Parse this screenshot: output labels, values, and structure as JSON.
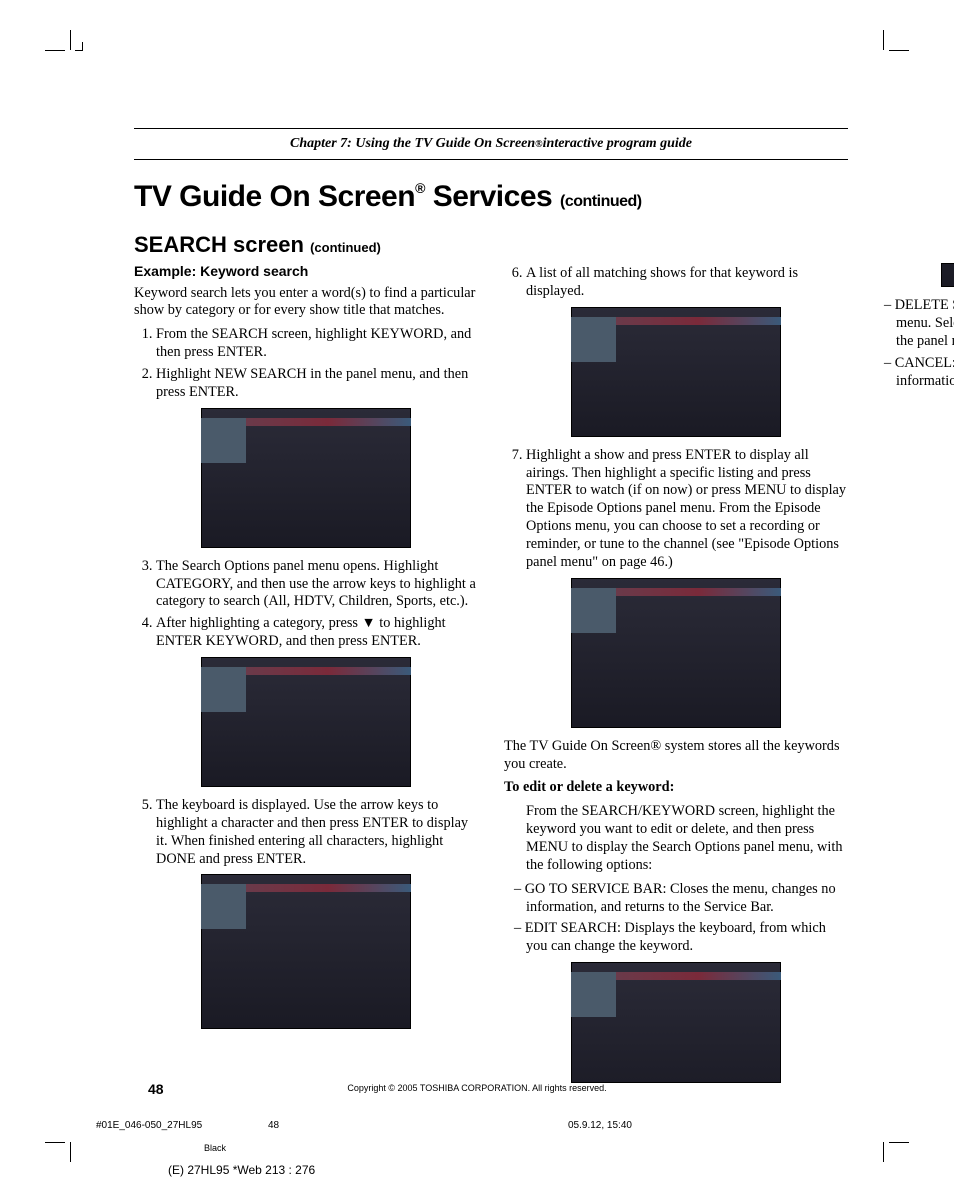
{
  "chapter": {
    "prefix": "Chapter 7: Using the TV Guide On Screen",
    "suffix": " interactive program guide"
  },
  "title": {
    "main1": "TV Guide On Screen",
    "main2": " Services ",
    "cont": "(continued)"
  },
  "subtitle": {
    "main": "SEARCH screen ",
    "cont": "(continued)"
  },
  "left": {
    "h4": "Example: Keyword search",
    "intro": "Keyword search lets you enter a word(s) to find a particular show by category or for every show title that matches.",
    "li1": "From the SEARCH screen, highlight KEYWORD, and then press ENTER.",
    "li2": "Highlight NEW SEARCH in the panel menu, and then press ENTER.",
    "li3": "The Search Options panel menu opens. Highlight CATEGORY, and then use the arrow keys to highlight a category to search (All, HDTV, Children, Sports, etc.).",
    "li4a": "After highlighting a category, press ",
    "li4b": " to highlight ENTER KEYWORD, and then press ENTER.",
    "li5": "The keyboard is displayed. Use the arrow keys to highlight a character and then press ENTER to display it. When finished entering all characters, highlight DONE and press ENTER."
  },
  "right": {
    "li6": "A list of all matching shows for that keyword is displayed.",
    "li7": "Highlight a show and press ENTER to display all airings. Then highlight a specific listing and press ENTER to watch (if on now) or press MENU to display the Episode Options panel menu. From the Episode Options menu, you can choose to set a recording or reminder, or tune to the channel (see \"Episode Options panel menu\" on page 46.)",
    "store": "The TV Guide On Screen® system stores all the keywords you create.",
    "editHdr": "To edit or delete a keyword:",
    "editBody": "From the SEARCH/KEYWORD screen, highlight the keyword you want to edit or delete, and then press MENU to display the Search Options panel menu, with the following options:",
    "opt1": "GO TO SERVICE BAR: Closes the menu, changes no information, and returns to the Service Bar.",
    "opt2": "EDIT SEARCH: Displays the keyboard, from which you can change the keyword.",
    "opt3": "DELETE SEARCH: Displays the Confirmation panel menu. Select YES to delete the search or NO to close the panel menu.",
    "opt4": "CANCEL: Closes the panel menu, changes no information, and returns to the highlighted keyword."
  },
  "footer": {
    "copyright": "Copyright © 2005 TOSHIBA CORPORATION. All rights reserved.",
    "pageNum": "48",
    "jobLeft": "#01E_046-050_27HL95",
    "jobMid": "48",
    "jobRight": "05.9.12, 15:40",
    "black": "Black",
    "web": "(E) 27HL95 *Web 213 : 276"
  },
  "glyphs": {
    "down": "▼"
  }
}
